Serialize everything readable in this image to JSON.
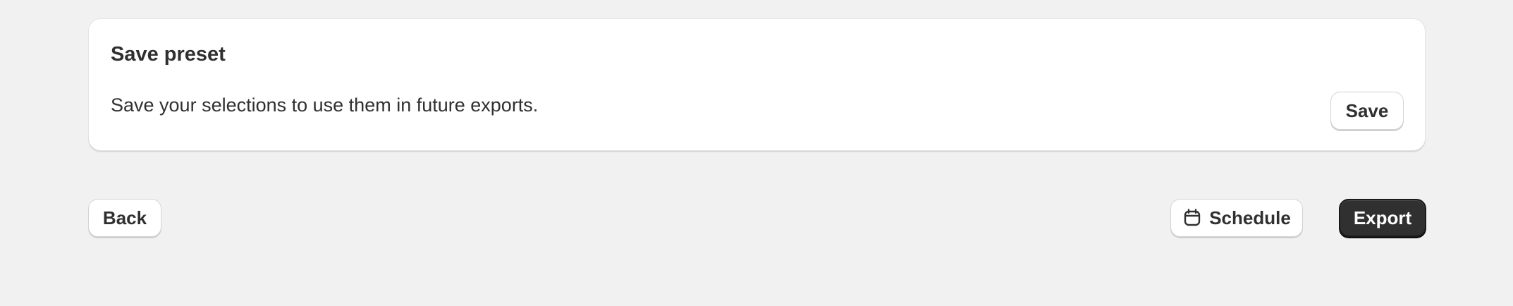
{
  "preset_card": {
    "title": "Save preset",
    "description": "Save your selections to use them in future exports.",
    "save_label": "Save"
  },
  "footer": {
    "back_label": "Back",
    "schedule_label": "Schedule",
    "schedule_icon": "calendar-icon",
    "export_label": "Export"
  },
  "colors": {
    "background": "#f1f1f1",
    "card": "#ffffff",
    "text": "#303030",
    "primary_button": "#303030"
  }
}
